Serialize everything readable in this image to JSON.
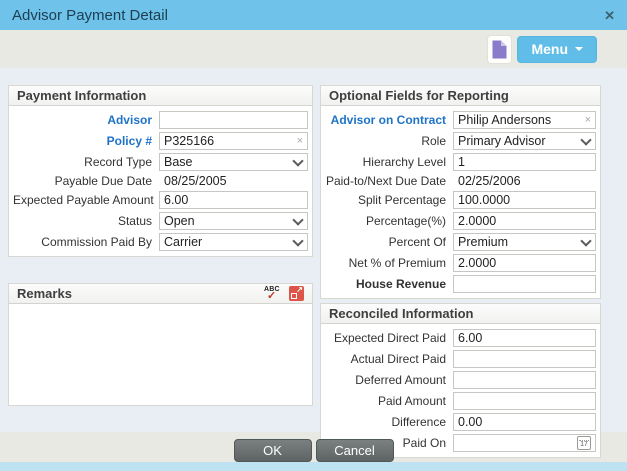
{
  "window": {
    "title": "Advisor Payment Detail",
    "close_glyph": "✕"
  },
  "toolbar": {
    "menu_label": "Menu"
  },
  "payment": {
    "title": "Payment Information",
    "fields": [
      {
        "label": "Advisor",
        "value": "",
        "type": "text",
        "link": true
      },
      {
        "label": "Policy #",
        "value": "P325166",
        "type": "clearable",
        "link": true
      },
      {
        "label": "Record Type",
        "value": "Base",
        "type": "select"
      },
      {
        "label": "Payable Due Date",
        "value": "08/25/2005",
        "type": "readonly"
      },
      {
        "label": "Expected Payable Amount",
        "value": "6.00",
        "type": "text"
      },
      {
        "label": "Status",
        "value": "Open",
        "type": "select"
      },
      {
        "label": "Commission Paid By",
        "value": "Carrier",
        "type": "select"
      }
    ]
  },
  "remarks": {
    "title": "Remarks",
    "value": "",
    "spellcheck_text": "ABC",
    "spellcheck_mark": "✓",
    "expand_arrow": "↗"
  },
  "optional": {
    "title": "Optional Fields for Reporting",
    "fields": [
      {
        "label": "Advisor on Contract",
        "value": "Philip Andersons",
        "type": "clearable",
        "link": true
      },
      {
        "label": "Role",
        "value": "Primary Advisor",
        "type": "select"
      },
      {
        "label": "Hierarchy Level",
        "value": "1",
        "type": "text"
      },
      {
        "label": "Paid-to/Next Due Date",
        "value": "02/25/2006",
        "type": "readonly"
      },
      {
        "label": "Split Percentage",
        "value": "100.0000",
        "type": "text"
      },
      {
        "label": "Percentage(%)",
        "value": "2.0000",
        "type": "text"
      },
      {
        "label": "Percent Of",
        "value": "Premium",
        "type": "select"
      },
      {
        "label": "Net % of Premium",
        "value": "2.0000",
        "type": "text"
      },
      {
        "label": "House Revenue",
        "value": "",
        "type": "text"
      }
    ]
  },
  "reconciled": {
    "title": "Reconciled Information",
    "fields": [
      {
        "label": "Expected Direct Paid",
        "value": "6.00",
        "type": "text"
      },
      {
        "label": "Actual Direct Paid",
        "value": "",
        "type": "text"
      },
      {
        "label": "Deferred Amount",
        "value": "",
        "type": "text"
      },
      {
        "label": "Paid Amount",
        "value": "",
        "type": "text"
      },
      {
        "label": "Difference",
        "value": "0.00",
        "type": "text"
      },
      {
        "label": "Paid On",
        "value": "",
        "type": "date"
      }
    ]
  },
  "footer": {
    "ok_label": "OK",
    "cancel_label": "Cancel"
  },
  "icons": {
    "clear_glyph": "×",
    "calendar_day": "17"
  },
  "colors": {
    "titlebar": "#6fc2e9",
    "accent_button": "#5fbde7",
    "link": "#1e73c8",
    "doc_icon_purple": "#8a7bcb",
    "alert_red": "#dd5449",
    "footer_button": "#5e6364",
    "bottom_strip": "#bfe2f3",
    "content_bg": "#e9edf4"
  }
}
